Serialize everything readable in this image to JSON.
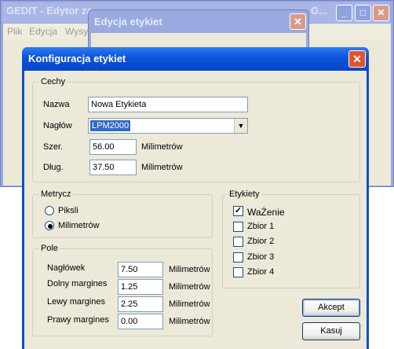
{
  "bg_window": {
    "title": "GEDIT - Edytor za",
    "title_tail": "G...",
    "menu": [
      "Plik",
      "Edycja",
      "Wysył"
    ],
    "minimize_glyph": "_",
    "maximize_glyph": "□",
    "close_glyph": "✕"
  },
  "mid_dialog": {
    "title": "Edycja etykiet",
    "close_glyph": "✕"
  },
  "dialog": {
    "title": "Konfiguracja etykiet",
    "close_glyph": "✕",
    "cechy": {
      "group_label": "Cechy",
      "nazwa_label": "Nazwa",
      "nazwa_value": "Nowa Etykieta",
      "naglow_label": "Nagłów",
      "naglow_value": "LPM2000",
      "szer_label": "Szer.",
      "szer_value": "56.00",
      "szer_unit": "Milimetrów",
      "dlug_label": "Dług.",
      "dlug_value": "37.50",
      "dlug_unit": "Milimetrów"
    },
    "metrycz": {
      "group_label": "Metrycz",
      "options": [
        "Piksli",
        "Milimetrów"
      ],
      "selected": "Milimetrów"
    },
    "pole": {
      "group_label": "Pole",
      "rows": [
        {
          "label": "Nagłówek",
          "value": "7.50",
          "unit": "Milimetrów"
        },
        {
          "label": "Dolny margines",
          "value": "1.25",
          "unit": "Milimetrów"
        },
        {
          "label": "Lewy margines",
          "value": "2.25",
          "unit": "Milimetrów"
        },
        {
          "label": "Prawy margines",
          "value": "0.00",
          "unit": "Milimetrów"
        }
      ]
    },
    "etykiety": {
      "group_label": "Etykiety",
      "items": [
        {
          "label": "WaŻenie",
          "checked": true
        },
        {
          "label": "Zbior 1",
          "checked": false
        },
        {
          "label": "Zbior 2",
          "checked": false
        },
        {
          "label": "Zbior 3",
          "checked": false
        },
        {
          "label": "Zbior 4",
          "checked": false
        }
      ]
    },
    "buttons": {
      "accept": "Akcept",
      "cancel": "Kasuj"
    }
  }
}
